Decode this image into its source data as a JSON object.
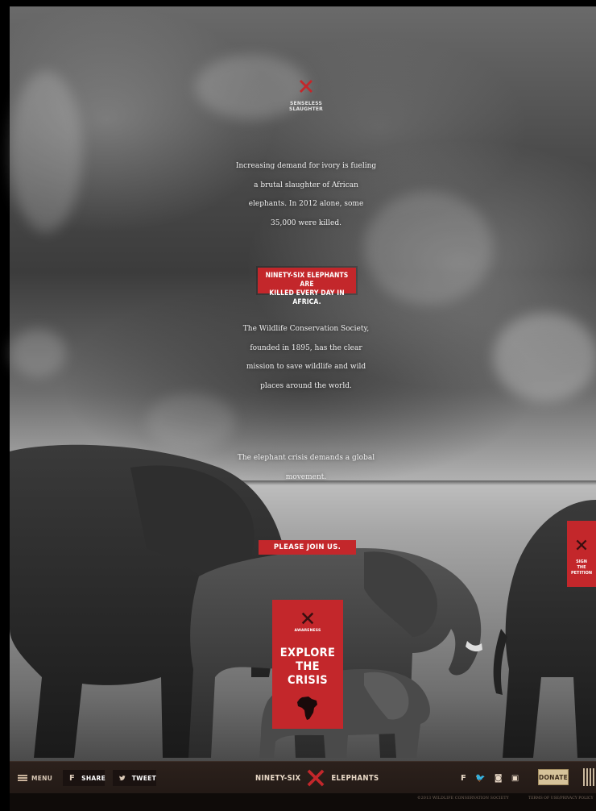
{
  "logo": {
    "icon": "x-cross-icon",
    "caption_line1": "SENSELESS",
    "caption_line2": "SLAUGHTER"
  },
  "paragraphs": {
    "p1": "Increasing demand for ivory is fueling a brutal slaughter of African elephants. In 2012 alone, some 35,000 were killed.",
    "p2": "The Wildlife Conservation Society, founded in 1895, has the clear mission to save wildlife and wild places around the world.",
    "p3": "The elephant crisis demands a global movement."
  },
  "banner": {
    "line1": "NINETY-SIX ELEPHANTS ARE",
    "line2": "KILLED EVERY DAY IN AFRICA."
  },
  "join_button": "PLEASE JOIN US.",
  "explore_card": {
    "small": "AWARENESS",
    "line1": "EXPLORE",
    "line2": "THE",
    "line3": "CRISIS",
    "icon": "africa-map-icon"
  },
  "petition": {
    "line1": "SIGN",
    "line2": "THE",
    "line3": "PETITION",
    "icon": "x-cross-icon"
  },
  "bottom_bar": {
    "menu_label": "MENU",
    "share_label": "SHARE",
    "tweet_label": "TWEET",
    "brand_left": "NINETY-SIX",
    "brand_right": "ELEPHANTS",
    "donate_label": "DONATE",
    "social": {
      "facebook": "f",
      "twitter": "🐦",
      "instagram": "◙",
      "youtube": "▣"
    }
  },
  "footer": {
    "copyright": "©2013 WILDLIFE CONSERVATION SOCIETY",
    "terms": "TERMS OF USE/PRIVACY POLICY"
  },
  "colors": {
    "accent_red": "#c3272b",
    "bar_brown": "#2c211c",
    "donate_gold": "#d6c39a"
  }
}
